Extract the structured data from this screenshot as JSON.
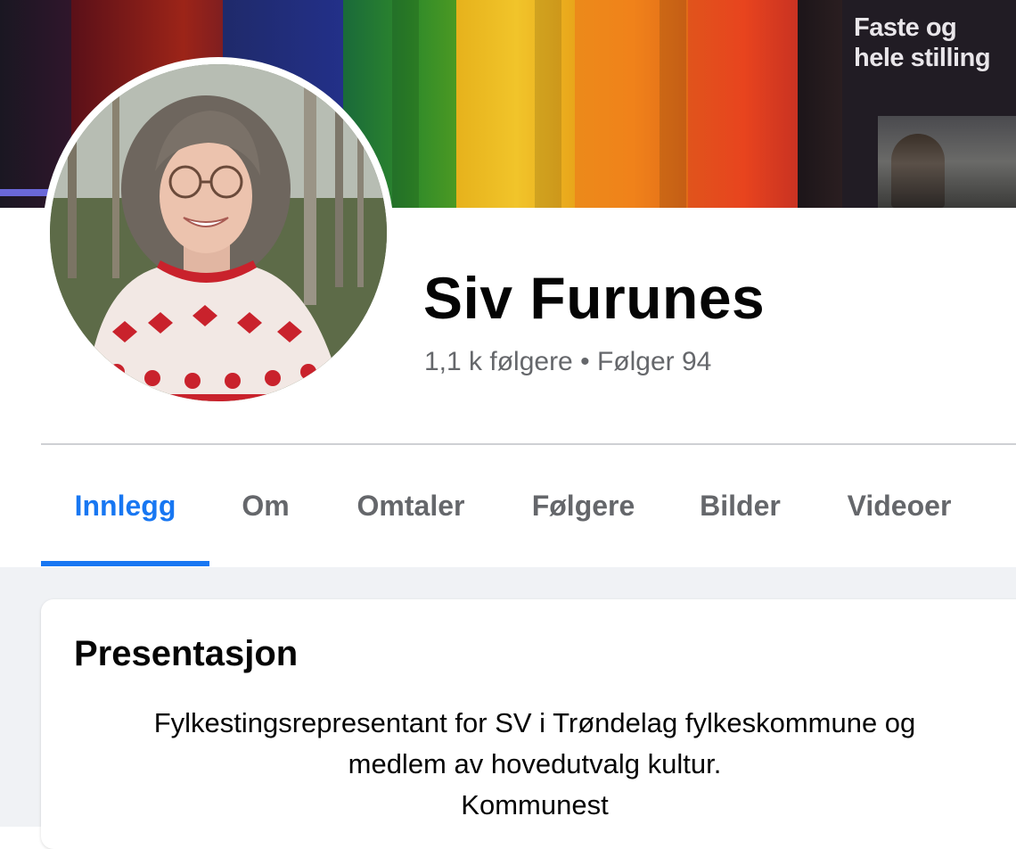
{
  "cover": {
    "poster_text_line1": "Faste og",
    "poster_text_line2": "hele stilling"
  },
  "profile": {
    "name": "Siv Furunes",
    "followers": "1,1 k følgere",
    "separator": " • ",
    "following": "Følger 94"
  },
  "tabs": [
    {
      "label": "Innlegg",
      "active": true
    },
    {
      "label": "Om",
      "active": false
    },
    {
      "label": "Omtaler",
      "active": false
    },
    {
      "label": "Følgere",
      "active": false
    },
    {
      "label": "Bilder",
      "active": false
    },
    {
      "label": "Videoer",
      "active": false
    }
  ],
  "intro": {
    "title": "Presentasjon",
    "bio_line1": "Fylkestingsrepresentant for SV i Trøndelag fylkeskommune og",
    "bio_line2": "medlem av hovedutvalg kultur.",
    "bio_line3": "Kommunest"
  },
  "colors": {
    "accent": "#1877f2",
    "secondary_text": "#65676b",
    "feed_background": "#f0f2f5"
  }
}
